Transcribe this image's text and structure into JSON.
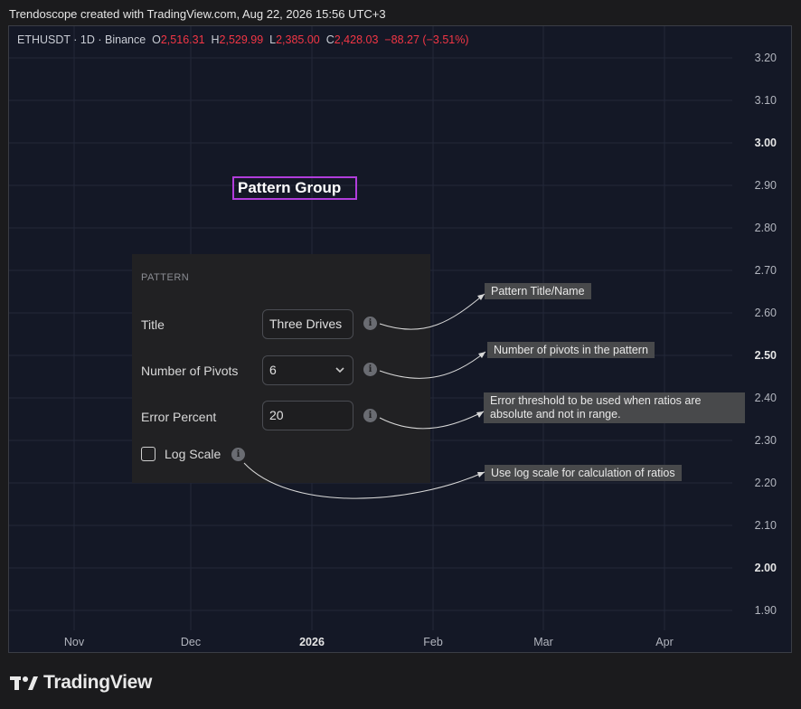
{
  "header": {
    "credit": "Trendoscope created with TradingView.com, Aug 22, 2026 15:56 UTC+3"
  },
  "symbol_bar": {
    "symbol": "ETHUSDT · 1D · Binance",
    "o_label": "O",
    "o_value": "2,516.31",
    "h_label": "H",
    "h_value": "2,529.99",
    "l_label": "L",
    "l_value": "2,385.00",
    "c_label": "C",
    "c_value": "2,428.03",
    "change": "−88.27 (−3.51%)"
  },
  "y_axis": [
    "3.20",
    "3.10",
    "3.00",
    "2.90",
    "2.80",
    "2.70",
    "2.60",
    "2.50",
    "2.40",
    "2.30",
    "2.20",
    "2.10",
    "2.00",
    "1.90"
  ],
  "x_axis": [
    "Nov",
    "Dec",
    "2026",
    "Feb",
    "Mar",
    "Apr"
  ],
  "group_title": "Pattern Group",
  "panel": {
    "section": "PATTERN",
    "title_label": "Title",
    "title_value": "Three Drives",
    "pivots_label": "Number of Pivots",
    "pivots_value": "6",
    "error_label": "Error Percent",
    "error_value": "20",
    "log_label": "Log Scale",
    "log_checked": false,
    "info_glyph": "i"
  },
  "tooltips": {
    "title": "Pattern Title/Name",
    "pivots": "Number of pivots in the pattern",
    "error": "Error threshold to be used when ratios are absolute and not in range.",
    "log": "Use log scale for calculation of ratios"
  },
  "footer": {
    "brand": "TradingView"
  },
  "colors": {
    "chart_bg": "#141826",
    "accent_border": "#b13ddb",
    "negative": "#f23645"
  }
}
